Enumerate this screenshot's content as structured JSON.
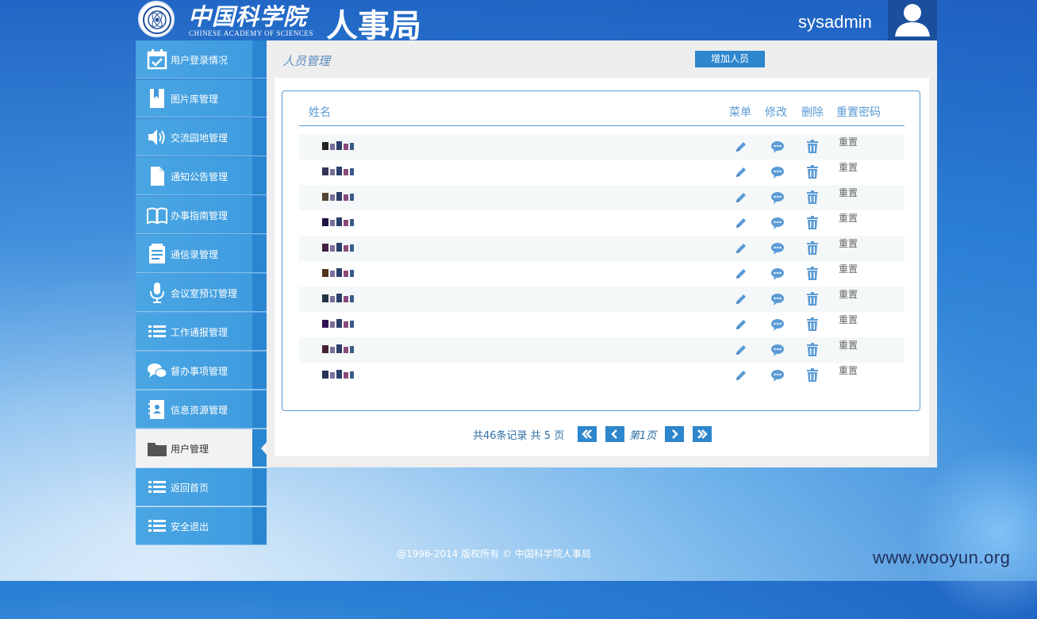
{
  "header": {
    "logo_cn": "中国科学院",
    "logo_en": "CHINESE ACADEMY OF SCIENCES",
    "bureau": "人事局",
    "username": "sysadmin"
  },
  "sidebar": {
    "items": [
      {
        "label": "用户登录情况",
        "icon": "calendar-check-icon"
      },
      {
        "label": "图片库管理",
        "icon": "bookmark-icon"
      },
      {
        "label": "交流园地管理",
        "icon": "speaker-icon"
      },
      {
        "label": "通知公告管理",
        "icon": "document-icon"
      },
      {
        "label": "办事指南管理",
        "icon": "book-icon"
      },
      {
        "label": "通信录管理",
        "icon": "clipboard-icon"
      },
      {
        "label": "会议室预订管理",
        "icon": "microphone-icon"
      },
      {
        "label": "工作通报管理",
        "icon": "list-icon"
      },
      {
        "label": "督办事项管理",
        "icon": "chat-bubbles-icon"
      },
      {
        "label": "信息资源管理",
        "icon": "contact-book-icon"
      },
      {
        "label": "用户管理",
        "icon": "folder-icon",
        "active": true
      },
      {
        "label": "返回首页",
        "icon": "list-icon"
      },
      {
        "label": "安全退出",
        "icon": "list-icon"
      }
    ]
  },
  "main": {
    "title": "人员管理",
    "add_button": "增加人员",
    "columns": {
      "name": "姓名",
      "menu": "菜单",
      "edit": "修改",
      "delete": "删除",
      "reset": "重置密码"
    },
    "rows": [
      {
        "reset": "重置"
      },
      {
        "reset": "重置"
      },
      {
        "reset": "重置"
      },
      {
        "reset": "重置"
      },
      {
        "reset": "重置"
      },
      {
        "reset": "重置"
      },
      {
        "reset": "重置"
      },
      {
        "reset": "重置"
      },
      {
        "reset": "重置"
      },
      {
        "reset": "重置"
      }
    ],
    "pagination": {
      "info": "共46条记录 共 5 页",
      "current": "第1页"
    }
  },
  "footer": "@1996-2014 版权所有 © 中国科学院人事局",
  "watermark": "www.wooyun.org",
  "colors": {
    "accent": "#2e86cc",
    "sidebar": "#4aa6e3",
    "link": "#5b9bd5"
  }
}
